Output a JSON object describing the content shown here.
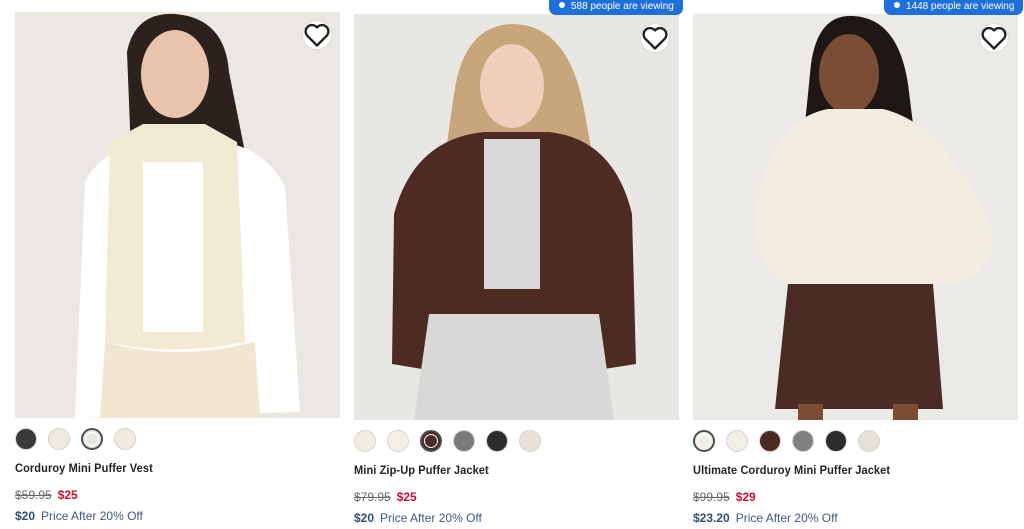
{
  "products": [
    {
      "name": "Corduroy Mini Puffer Vest",
      "was_price": "$59.95",
      "sale_price": "$25",
      "promo_price": "$20",
      "promo_text": "Price After 20% Off",
      "swatches": [
        "#3a3a3a",
        "#efe9df",
        "#e9e6dc",
        "#f1ebdd"
      ],
      "selected_swatch": 2
    },
    {
      "viewing_text": "588 people are viewing",
      "name": "Mini Zip-Up Puffer Jacket",
      "was_price": "$79.95",
      "sale_price": "$25",
      "promo_price": "$20",
      "promo_text": "Price After 20% Off",
      "swatches": [
        "#f1ebe2",
        "#f3efe4",
        "#4a2a22",
        "#7a7a7a",
        "#2b2b2b",
        "#e8e1d6"
      ],
      "selected_swatch": 2
    },
    {
      "viewing_text": "1448 people are viewing",
      "name": "Ultimate Corduroy Mini Puffer Jacket",
      "was_price": "$99.95",
      "sale_price": "$29",
      "promo_price": "$23.20",
      "promo_text": "Price After 20% Off",
      "swatches": [
        "#f2ede4",
        "#f3efe4",
        "#4a2a22",
        "#808080",
        "#2b2b2b",
        "#e6e1d8"
      ],
      "selected_swatch": 0
    }
  ],
  "icons": {
    "wishlist": "heart-outline-icon",
    "viewing": "live-dot-icon"
  },
  "colors": {
    "sale_red": "#c8102e",
    "promo_blue": "#2f4f74",
    "viewing_badge": "#1e6fd9"
  }
}
